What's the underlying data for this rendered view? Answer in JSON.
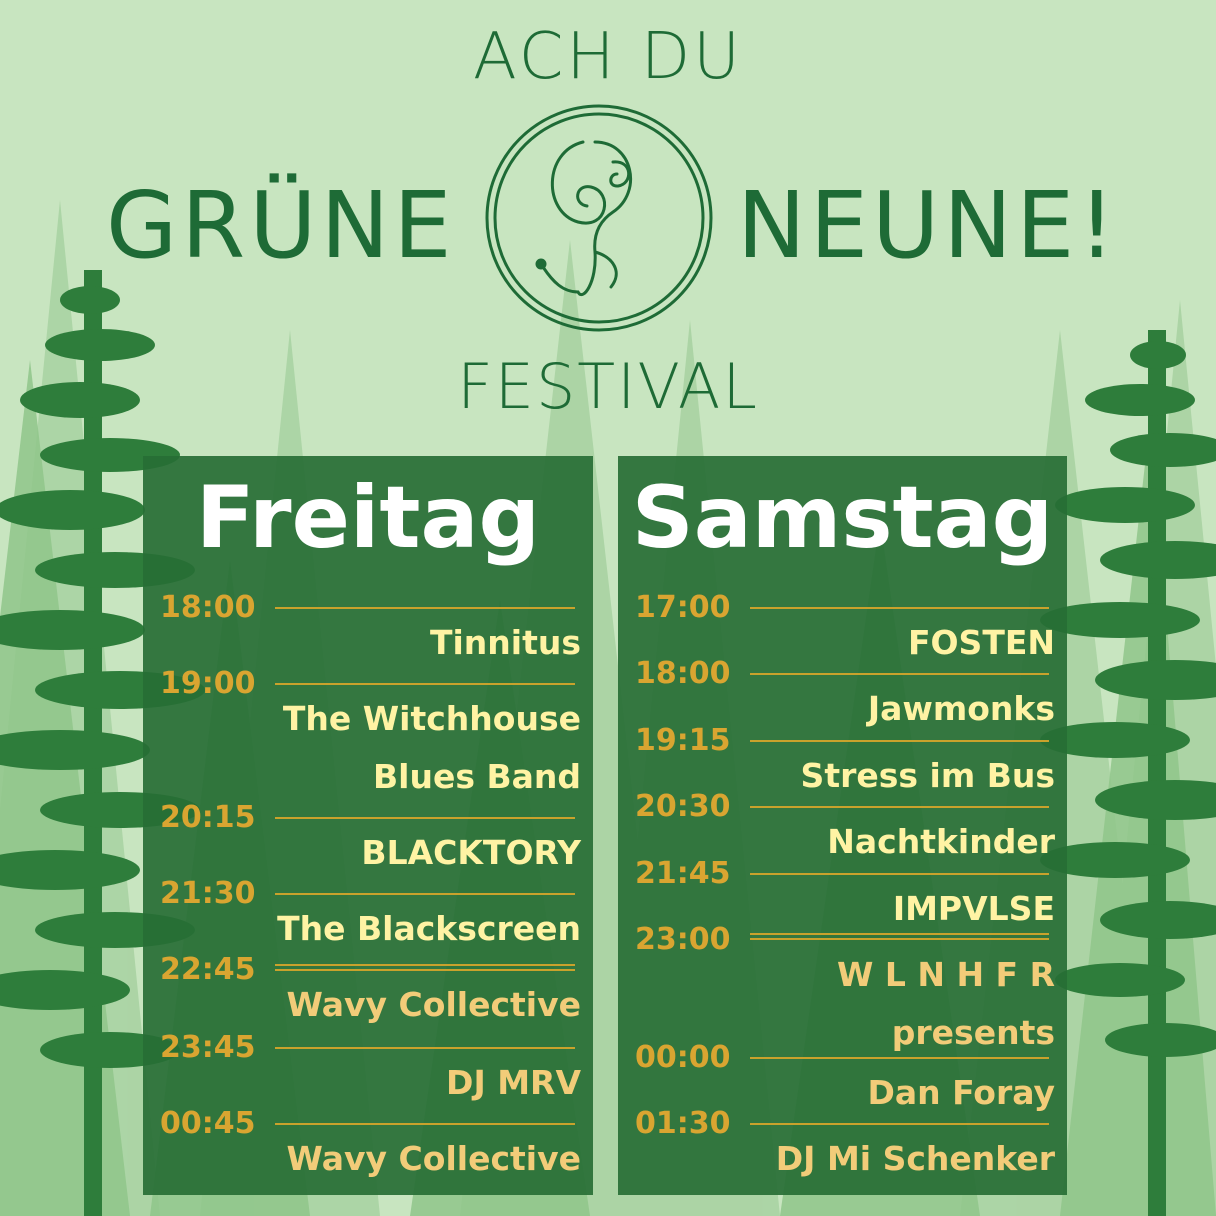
{
  "header": {
    "line1": "ACH DU",
    "word_left": "GRÜNE",
    "word_right": "NEUNE!",
    "line3": "FESTIVAL",
    "logo_icon": "swirl-circle-logo"
  },
  "colors": {
    "background": "#c8e5c0",
    "title_green": "#1e6b36",
    "panel": "#276e35",
    "time_gold": "#d9a531",
    "act_light": "#fff3a4",
    "act_warm": "#f2cc79"
  },
  "friday": {
    "day": "Freitag",
    "slots": [
      {
        "time": "18:00",
        "act_lines": [
          "Tinnitus"
        ]
      },
      {
        "time": "19:00",
        "act_lines": [
          "The Witchhouse",
          "Blues Band"
        ]
      },
      {
        "time": "20:15",
        "act_lines": [
          "BLACKTORY"
        ]
      },
      {
        "time": "21:30",
        "act_lines": [
          "The Blackscreen"
        ]
      },
      {
        "time": "22:45",
        "act_lines": [
          "Wavy Collective"
        ]
      },
      {
        "time": "23:45",
        "act_lines": [
          "DJ MRV"
        ]
      },
      {
        "time": "00:45",
        "act_lines": [
          "Wavy Collective"
        ]
      }
    ]
  },
  "saturday": {
    "day": "Samstag",
    "slots": [
      {
        "time": "17:00",
        "act_lines": [
          "FOSTEN"
        ]
      },
      {
        "time": "18:00",
        "act_lines": [
          "Jawmonks"
        ]
      },
      {
        "time": "19:15",
        "act_lines": [
          "Stress im Bus"
        ]
      },
      {
        "time": "20:30",
        "act_lines": [
          "Nachtkinder"
        ]
      },
      {
        "time": "21:45",
        "act_lines": [
          "IMPVLSE"
        ]
      },
      {
        "time": "23:00",
        "act_lines": [
          "W L N H F R",
          "presents"
        ]
      },
      {
        "time": "00:00",
        "act_lines": [
          "Dan Foray"
        ]
      },
      {
        "time": "01:30",
        "act_lines": [
          "DJ Mi Schenker"
        ]
      }
    ]
  }
}
